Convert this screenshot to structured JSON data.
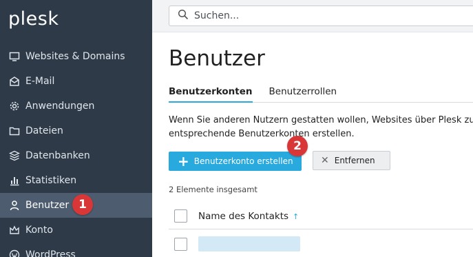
{
  "brand": {
    "logo_text": "plesk"
  },
  "sidebar": {
    "items": [
      {
        "label": "Websites & Domains",
        "icon": "monitor-icon"
      },
      {
        "label": "E-Mail",
        "icon": "mail-icon"
      },
      {
        "label": "Anwendungen",
        "icon": "gear-icon"
      },
      {
        "label": "Dateien",
        "icon": "folder-icon"
      },
      {
        "label": "Datenbanken",
        "icon": "database-icon"
      },
      {
        "label": "Statistiken",
        "icon": "bar-chart-icon"
      },
      {
        "label": "Benutzer",
        "icon": "user-icon",
        "active": true
      },
      {
        "label": "Konto",
        "icon": "crown-icon"
      },
      {
        "label": "WordPress",
        "icon": "wordpress-icon"
      }
    ]
  },
  "search": {
    "placeholder": "Suchen..."
  },
  "page": {
    "title": "Benutzer",
    "tabs": [
      {
        "label": "Benutzerkonten",
        "active": true
      },
      {
        "label": "Benutzerrollen"
      }
    ],
    "description_line1": "Wenn Sie anderen Nutzern gestatten wollen, Websites über Plesk zu",
    "description_line2": "entsprechende Benutzerkonten erstellen.",
    "create_button": "Benutzerkonto erstellen",
    "remove_button": "Entfernen",
    "count_text": "2 Elemente insgesamt",
    "column_name": "Name des Kontakts",
    "sort_indicator": "↑"
  },
  "annotations": {
    "badge_1": "1",
    "badge_2": "2"
  },
  "colors": {
    "sidebar_bg": "#2e3a48",
    "sidebar_active": "#4d5d6f",
    "accent": "#28aade",
    "badge": "#d93737"
  }
}
